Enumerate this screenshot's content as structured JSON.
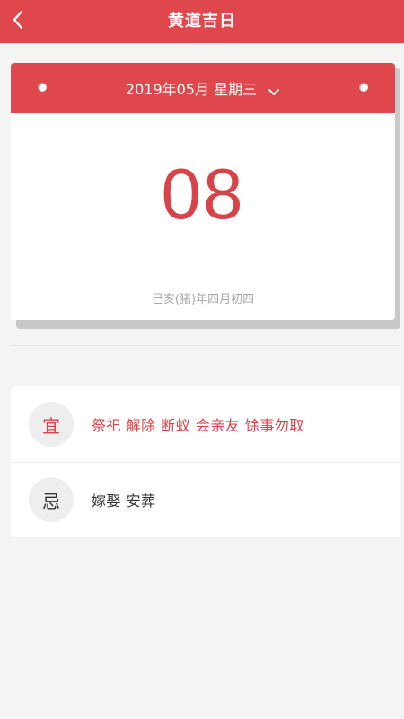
{
  "header": {
    "title": "黄道吉日"
  },
  "calendar": {
    "month_label": "2019年05月  星期三",
    "day": "08",
    "lunar": "己亥(猪)年四月初四"
  },
  "almanac": {
    "yi": {
      "badge": "宜",
      "items": "祭祀 解除 断蚁 会亲友 馀事勿取"
    },
    "ji": {
      "badge": "忌",
      "items": "嫁娶 安葬"
    }
  },
  "colors": {
    "primary": "#e0474c",
    "day_text": "#d8434a",
    "background": "#f4f4f4"
  }
}
